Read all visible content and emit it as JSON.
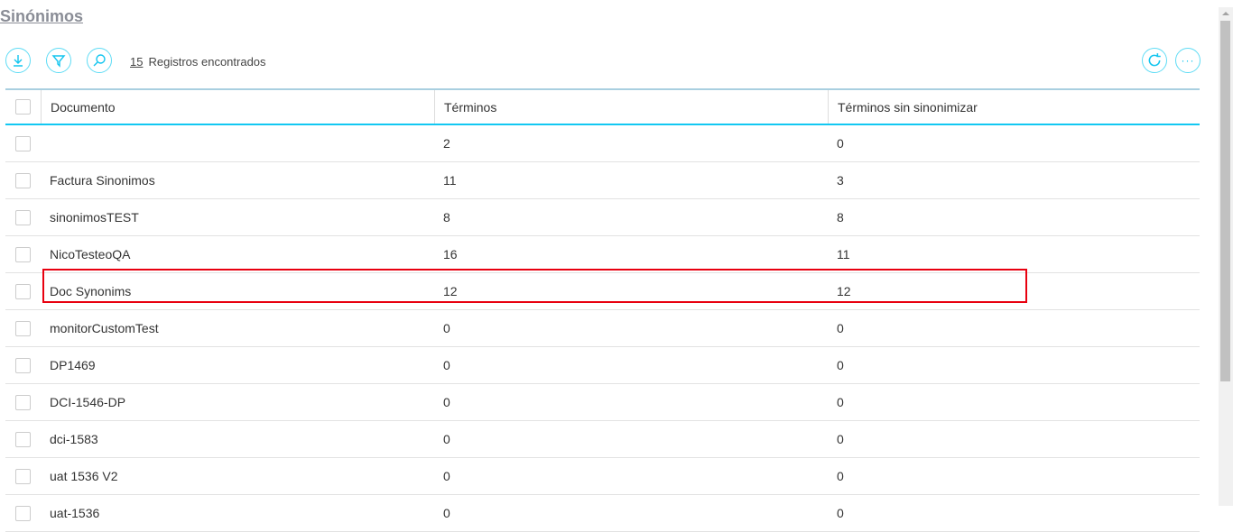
{
  "title": "Sinónimos",
  "count": "15",
  "count_label": "Registros encontrados",
  "columns": [
    "Documento",
    "Términos",
    "Términos sin sinonimizar"
  ],
  "rows": [
    [
      "",
      "2",
      "0"
    ],
    [
      "Factura Sinonimos",
      "11",
      "3"
    ],
    [
      "sinonimosTEST",
      "8",
      "8"
    ],
    [
      "NicoTesteoQA",
      "16",
      "11"
    ],
    [
      "Doc Synonims",
      "12",
      "12"
    ],
    [
      "monitorCustomTest",
      "0",
      "0"
    ],
    [
      "DP1469",
      "0",
      "0"
    ],
    [
      "DCI-1546-DP",
      "0",
      "0"
    ],
    [
      "dci-1583",
      "0",
      "0"
    ],
    [
      "uat 1536 V2",
      "0",
      "0"
    ],
    [
      "uat-1536",
      "0",
      "0"
    ]
  ]
}
